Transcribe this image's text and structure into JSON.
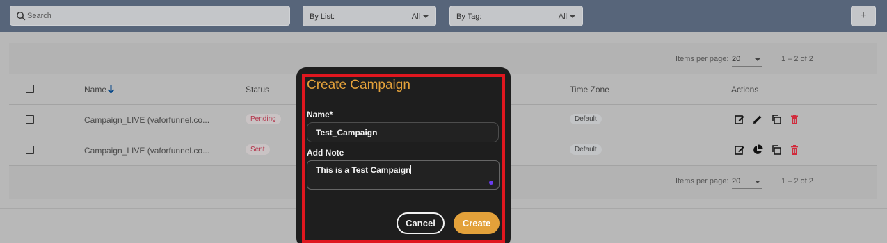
{
  "toolbar": {
    "search_placeholder": "Search",
    "by_list_label": "By List:",
    "by_list_value": "All",
    "by_tag_label": "By Tag:",
    "by_tag_value": "All",
    "add_label": "+"
  },
  "pager": {
    "items_per_page_label": "Items per page:",
    "items_per_page_value": "20",
    "range": "1 – 2 of 2"
  },
  "table": {
    "headers": {
      "name": "Name",
      "status": "Status",
      "time_zone": "Time Zone",
      "actions": "Actions"
    },
    "rows": [
      {
        "name": "Campaign_LIVE (vaforfunnel.co...",
        "status": "Pending",
        "time_zone": "Default"
      },
      {
        "name": "Campaign_LIVE (vaforfunnel.co...",
        "status": "Sent",
        "time_zone": "Default"
      }
    ]
  },
  "modal": {
    "title": "Create Campaign",
    "name_label": "Name*",
    "name_value": "Test_Campaign",
    "note_label": "Add Note",
    "note_value": "This is a Test Campaign",
    "cancel_label": "Cancel",
    "create_label": "Create"
  },
  "colors": {
    "accent": "#e3a13a",
    "highlight_frame": "#e0171f",
    "modal_bg": "#1e1e1e",
    "toolbar_bg": "#57657a"
  }
}
